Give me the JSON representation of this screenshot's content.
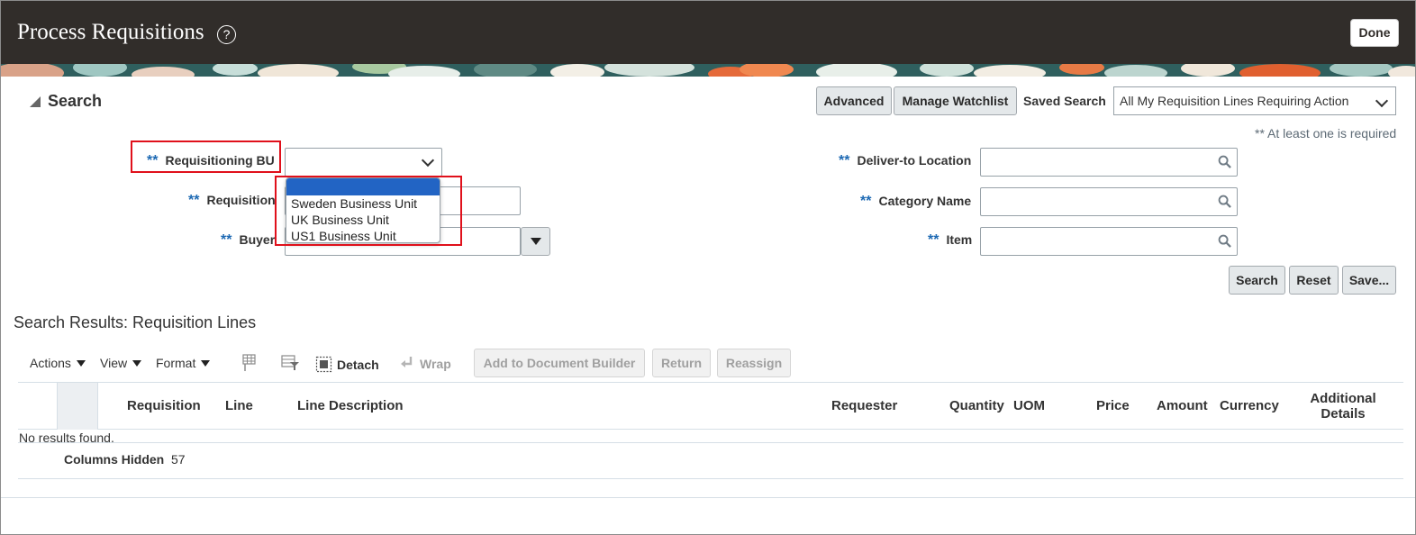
{
  "header": {
    "title": "Process Requisitions",
    "help_glyph": "?",
    "done_label": "Done"
  },
  "search": {
    "heading": "Search",
    "advanced_label": "Advanced",
    "manage_watchlist_label": "Manage Watchlist",
    "saved_search_label": "Saved Search",
    "saved_search_value": "All My Requisition Lines Requiring Action",
    "required_hint": "** At least one is required",
    "required_marker": "**",
    "fields": {
      "requisitioning_bu": {
        "label": "Requisitioning BU",
        "value": ""
      },
      "requisition": {
        "label": "Requisition",
        "value": ""
      },
      "buyer": {
        "label": "Buyer",
        "value": ""
      },
      "deliver_to_location": {
        "label": "Deliver-to Location",
        "value": ""
      },
      "category_name": {
        "label": "Category Name",
        "value": ""
      },
      "item": {
        "label": "Item",
        "value": ""
      }
    },
    "bu_dropdown": {
      "options": [
        "",
        "Sweden Business Unit",
        "UK Business Unit",
        "US1 Business Unit"
      ]
    },
    "search_label": "Search",
    "reset_label": "Reset",
    "save_label": "Save..."
  },
  "results": {
    "title": "Search Results: Requisition Lines",
    "toolbar": {
      "actions": "Actions",
      "view": "View",
      "format": "Format",
      "detach": "Detach",
      "wrap": "Wrap",
      "add_to_document_builder": "Add to Document Builder",
      "return": "Return",
      "reassign": "Reassign"
    },
    "columns": [
      "Requisition",
      "Line",
      "Line Description",
      "Requester",
      "Quantity",
      "UOM",
      "Price",
      "Amount",
      "Currency",
      "Additional Details"
    ],
    "empty_message": "No results found.",
    "columns_hidden_label": "Columns Hidden",
    "columns_hidden_count": "57"
  },
  "colors": {
    "header_bg": "#312d2a",
    "required_star": "#1d69b3",
    "dropdown_highlight": "#2264c4",
    "annotation_red": "#e0101b"
  },
  "icons": [
    "help-icon",
    "collapse-triangle-icon",
    "chevron-down-icon",
    "search-icon",
    "freeze-columns-icon",
    "filter-icon",
    "detach-icon",
    "wrap-icon",
    "dropdown-arrow-icon"
  ]
}
